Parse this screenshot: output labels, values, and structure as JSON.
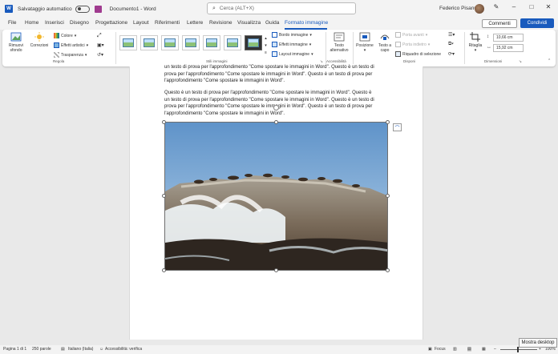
{
  "titlebar": {
    "autosave_label": "Salvataggio automatico",
    "document_title": "Documento1 - Word",
    "search_placeholder": "Cerca (ALT+X)",
    "user_name": "Federico Pisanu"
  },
  "menu": {
    "tabs": [
      "File",
      "Home",
      "Inserisci",
      "Disegno",
      "Progettazione",
      "Layout",
      "Riferimenti",
      "Lettere",
      "Revisione",
      "Visualizza",
      "Guida",
      "Formato immagine"
    ],
    "active_tab": "Formato immagine",
    "comments_label": "Commenti",
    "share_label": "Condividi"
  },
  "ribbon": {
    "remove_bg": [
      "Rimuovi",
      "sfondo"
    ],
    "corrections": "Correzioni",
    "color": "Colore",
    "artistic_effects": "Effetti artistici",
    "transparency": "Trasparenza",
    "group_adjust": "Regola",
    "group_styles": "Stili immagini",
    "border": "Bordo immagine",
    "effects": "Effetti immagine",
    "layout": "Layout immagine",
    "alt_text": [
      "Testo",
      "alternativo"
    ],
    "group_accessibility": "Accessibilità",
    "position": "Posizione",
    "wrap_text": [
      "Testo a",
      "capo"
    ],
    "bring_forward": "Porta avanti",
    "send_backward": "Porta indietro",
    "selection_pane": "Riquadro di selezione",
    "group_arrange": "Disponi",
    "crop": "Ritaglia",
    "height": "10,66 cm",
    "width": "15,92 cm",
    "group_size": "Dimensioni"
  },
  "document": {
    "paragraph1": [
      "un testo di prova per l'approfondimento \"Come spostare le immagini in Word\". Questo è un testo di",
      "prova per l'approfondimento \"Come spostare le immagini in Word\". Questo è un testo di prova per",
      "l'approfondimento \"Come spostare le immagini in Word\"."
    ],
    "paragraph2": [
      "Questo è un testo di prova per l'approfondimento \"Come spostare le immagini in Word\". Questo è",
      "un testo di prova per l'approfondimento \"Come spostare le immagini in Word\". Questo è un testo di",
      "prova per l'approfondimento \"Come spostare le immagini in Word\". Questo è un testo di prova per",
      "l'approfondimento \"Come spostare le immagini in Word\"."
    ]
  },
  "statusbar": {
    "page": "Pagina 1 di 1",
    "words": "250 parole",
    "language": "Italiano (Italia)",
    "accessibility": "Accessibilità: verifica",
    "focus": "Focus",
    "zoom": "100%",
    "tooltip": "Mostra desktop"
  },
  "colors": {
    "accent": "#185abd",
    "ribbon_bg": "#ffffff",
    "chrome_bg": "#f3f3f3"
  }
}
